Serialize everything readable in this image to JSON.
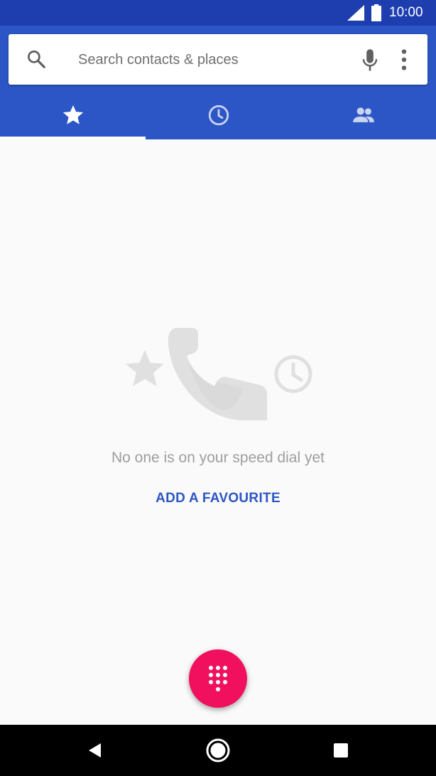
{
  "status_bar": {
    "time": "10:00",
    "icons": [
      "cell-signal-icon",
      "battery-icon"
    ]
  },
  "search": {
    "placeholder": "Search contacts & places",
    "value": "",
    "icons": [
      "search-icon",
      "microphone-icon",
      "more-vert-icon"
    ]
  },
  "tabs": [
    {
      "icon": "star-icon",
      "selected": true
    },
    {
      "icon": "clock-icon",
      "selected": false
    },
    {
      "icon": "people-icon",
      "selected": false
    }
  ],
  "empty_state": {
    "message": "No one is on your speed dial yet",
    "action_label": "ADD A FAVOURITE"
  },
  "fab": {
    "icon": "dialpad-icon"
  },
  "nav_bar": {
    "icons": [
      "back-icon",
      "home-icon",
      "recents-icon"
    ]
  },
  "colors": {
    "status_bar": "#1e3eb0",
    "app_bar": "#2c56c6",
    "fab": "#f0105e",
    "accent_text": "#2c56c6",
    "empty_illustration": "#e0e0e0"
  }
}
